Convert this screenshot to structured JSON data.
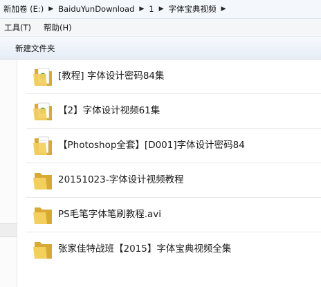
{
  "breadcrumb": {
    "items": [
      "新加卷 (E:)",
      "BaiduYunDownload",
      "1",
      "字体宝典视频"
    ]
  },
  "menu": {
    "items": [
      "工具(T)",
      "帮助(H)"
    ]
  },
  "toolbar": {
    "new_folder_label": "新建文件夹"
  },
  "files": [
    {
      "name": "[教程] 字体设计密码84集",
      "icon": "folder-with-document-icon"
    },
    {
      "name": "【2】字体设计视频61集",
      "icon": "folder-with-document-icon"
    },
    {
      "name": "【Photoshop全套】[D001]字体设计密码84",
      "icon": "folder-with-paper-icon"
    },
    {
      "name": "20151023-字体设计视频教程",
      "icon": "folder-icon"
    },
    {
      "name": "PS毛笔字体笔刷教程.avi",
      "icon": "folder-icon"
    },
    {
      "name": "张家佳特战班【2015】字体宝典视频全集",
      "icon": "folder-icon"
    }
  ],
  "colors": {
    "folder_front": "#f3cf5e",
    "folder_back": "#d9a936",
    "doc_green": "#3aa63a"
  }
}
